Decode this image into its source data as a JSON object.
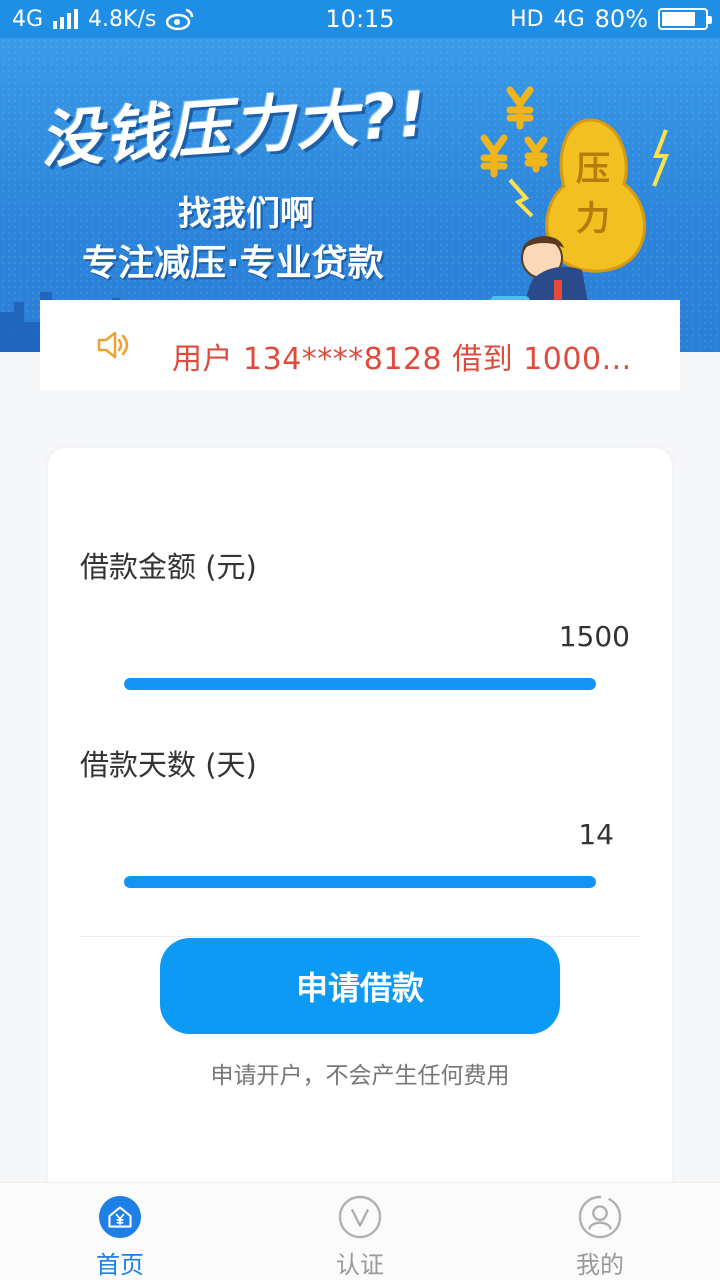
{
  "status_bar": {
    "network_left": "4G",
    "speed": "4.8K/s",
    "time": "10:15",
    "hd": "HD",
    "network_right": "4G",
    "battery": "80%",
    "battery_level": 0.8,
    "icons": [
      "signal-icon",
      "weibo-icon",
      "battery-icon"
    ]
  },
  "banner": {
    "title": "没钱压力大?!",
    "subtitle1": "找我们啊",
    "subtitle2": "专注减压·专业贷款",
    "illustration_text": [
      "压",
      "力"
    ]
  },
  "notice": {
    "icon": "speaker-icon",
    "text": "用户 134****8128 借到 1000..."
  },
  "loan_form": {
    "amount_label": "借款金额 (元)",
    "amount_value": "1500",
    "amount_slider_level": 1.0,
    "days_label": "借款天数 (天)",
    "days_value": "14",
    "days_slider_level": 1.0,
    "apply_button": "申请借款",
    "apply_note": "申请开户，不会产生任何费用"
  },
  "bottom_nav": {
    "items": [
      {
        "label": "首页",
        "icon": "home-icon",
        "active": true
      },
      {
        "label": "认证",
        "icon": "verify-icon",
        "active": false
      },
      {
        "label": "我的",
        "icon": "profile-icon",
        "active": false
      }
    ]
  },
  "colors": {
    "primary": "#0c9af5",
    "status_bar": "#1f8fe6",
    "notice_text": "#e04a3c",
    "nav_active": "#1e7fe6"
  }
}
